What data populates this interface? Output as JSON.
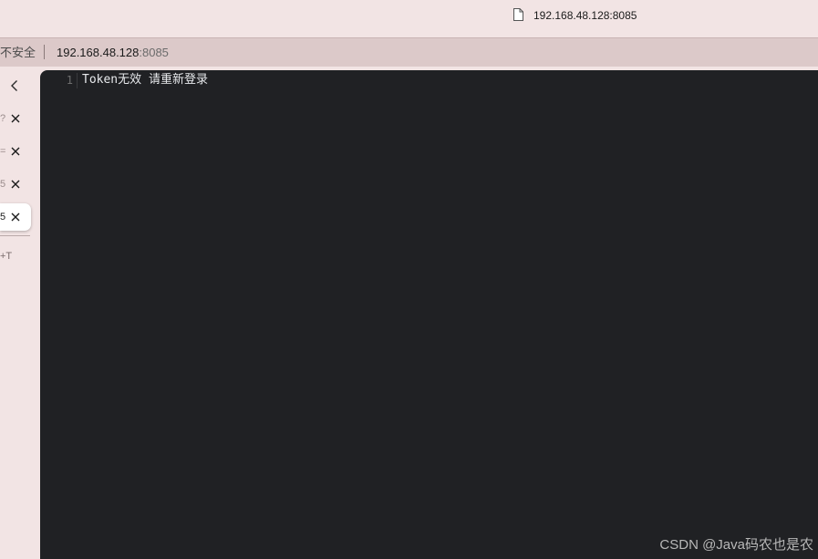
{
  "window": {
    "title": "192.168.48.128:8085",
    "file_icon": "file-icon"
  },
  "addressbar": {
    "security_label": "不安全",
    "url_host": "192.168.48.128",
    "url_port": ":8085"
  },
  "sidebar": {
    "collapse_icon": "chevron-left-icon",
    "tabs": [
      {
        "fragment": "?",
        "close_icon": "close-icon",
        "active": false
      },
      {
        "fragment": "=",
        "close_icon": "close-icon",
        "active": false
      },
      {
        "fragment": "5",
        "close_icon": "close-icon",
        "active": false
      },
      {
        "fragment": "5",
        "close_icon": "close-icon",
        "active": true
      }
    ],
    "shortcut_hint": "+T"
  },
  "document": {
    "line_number": "1",
    "line_text": "Token无效 请重新登录"
  },
  "watermark": "CSDN @Java码农也是农",
  "colors": {
    "chrome_bg": "#f2e4e4",
    "addressbar_bg": "#dcc9c9",
    "content_bg": "#202124",
    "text_light": "#e8eaed"
  }
}
